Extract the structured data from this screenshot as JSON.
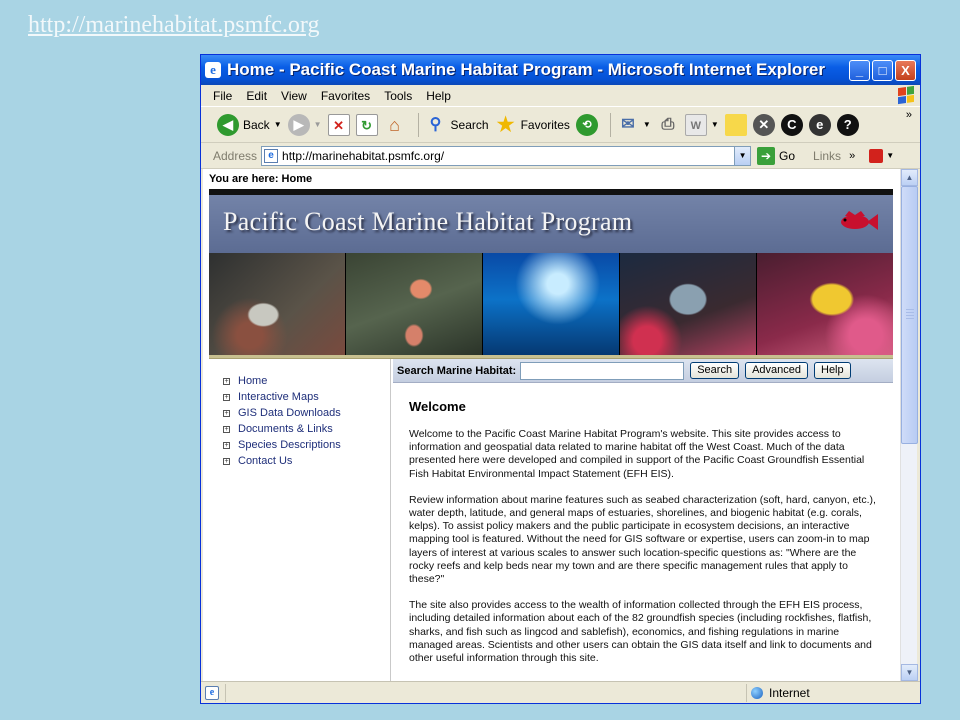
{
  "slide": {
    "link_text": "http://marinehabitat.psmfc.org"
  },
  "window": {
    "title": "Home - Pacific Coast Marine Habitat Program - Microsoft Internet Explorer",
    "icon_glyph": "e",
    "controls": {
      "minimize": "_",
      "maximize": "□",
      "close": "X"
    }
  },
  "menu": [
    "File",
    "Edit",
    "View",
    "Favorites",
    "Tools",
    "Help"
  ],
  "toolbar": {
    "back_label": "Back",
    "search_label": "Search",
    "favorites_label": "Favorites",
    "chevron": "»"
  },
  "address": {
    "label": "Address",
    "url": "http://marinehabitat.psmfc.org/",
    "go_label": "Go",
    "links_label": "Links",
    "links_chevron": "»"
  },
  "page": {
    "breadcrumb": "You are here: Home",
    "banner_title": "Pacific Coast Marine Habitat Program",
    "nav": [
      "Home",
      "Interactive Maps",
      "GIS Data Downloads",
      "Documents & Links",
      "Species Descriptions",
      "Contact Us"
    ],
    "search": {
      "label": "Search Marine Habitat:",
      "value": "",
      "buttons": [
        "Search",
        "Advanced",
        "Help"
      ]
    },
    "heading": "Welcome",
    "paragraphs": [
      "Welcome to the Pacific Coast Marine Habitat Program's website. This site provides access to information and geospatial data related to marine habitat off the West Coast.  Much of the data presented here were developed and compiled in support of the Pacific Coast Groundfish Essential Fish Habitat Environmental Impact Statement (EFH EIS).",
      "Review information about marine features such as seabed characterization (soft, hard, canyon, etc.), water depth, latitude, and general maps of estuaries, shorelines, and biogenic habitat (e.g. corals, kelps).   To assist policy makers and the public participate in ecosystem decisions, an interactive mapping tool is featured.  Without the need for GIS software or expertise, users can zoom-in to map layers of interest at various scales to answer such location-specific questions as:  \"Where are the rocky reefs and kelp beds near my town and are there specific management rules that apply to these?\"",
      "The site also provides access to the wealth of information collected through the EFH EIS process, including detailed information about each of the 82 groundfish species (including rockfishes, flatfish, sharks, and fish such as lingcod and sablefish), economics, and fishing regulations in marine managed areas.  Scientists and other users can obtain the GIS data itself and link to documents and other useful information through this site."
    ]
  },
  "status": {
    "zone": "Internet"
  },
  "scroll": {
    "position_fraction": 0.0
  },
  "colors": {
    "titlebar": "#0a5ee6",
    "desktop": "#a9d4e4",
    "nav_link": "#1f2f7a",
    "banner": "#6474a0"
  }
}
